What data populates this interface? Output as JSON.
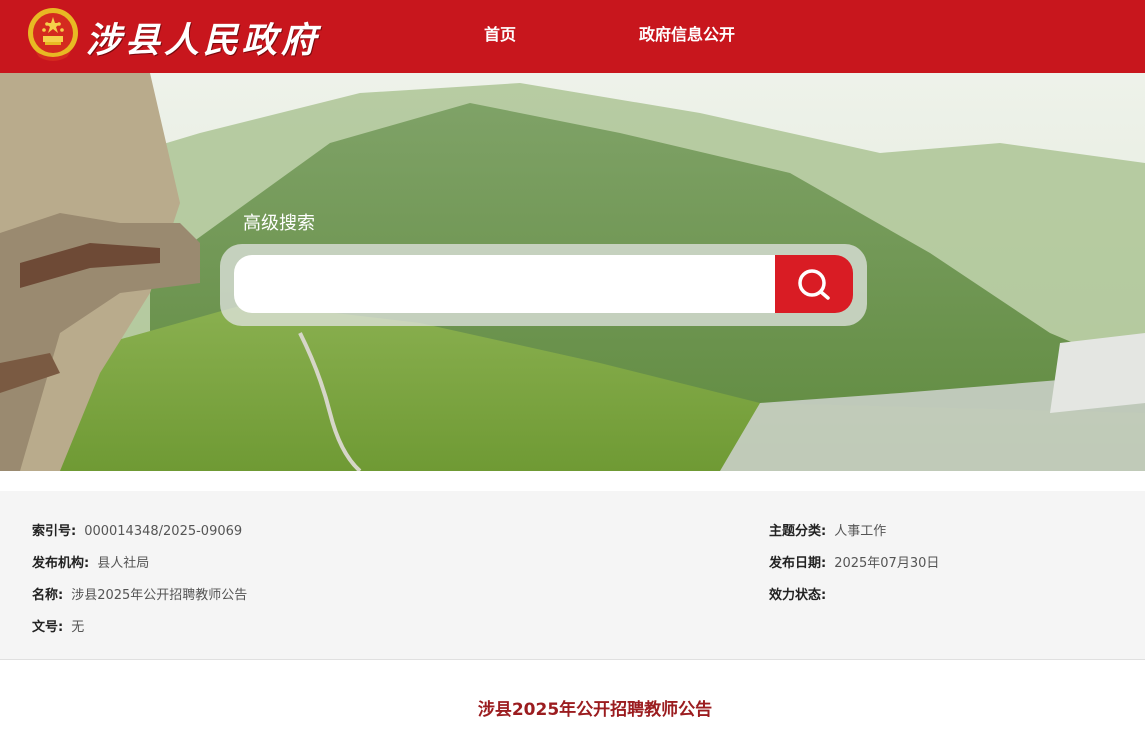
{
  "header": {
    "site_title": "涉县人民政府",
    "nav": {
      "home": "首页",
      "gov_info": "政府信息公开"
    }
  },
  "search": {
    "label": "高级搜索",
    "value": "",
    "placeholder": ""
  },
  "info": {
    "left": [
      {
        "key": "索引号:",
        "value": "000014348/2025-09069"
      },
      {
        "key": "发布机构:",
        "value": "县人社局"
      },
      {
        "key": "名称:",
        "value": "涉县2025年公开招聘教师公告"
      },
      {
        "key": "文号:",
        "value": "无"
      }
    ],
    "right": [
      {
        "key": "主题分类:",
        "value": "人事工作"
      },
      {
        "key": "发布日期:",
        "value": "2025年07月30日"
      },
      {
        "key": "效力状态:",
        "value": ""
      }
    ]
  },
  "article": {
    "title": "涉县2025年公开招聘教师公告"
  },
  "colors": {
    "header_red": "#c8161d",
    "button_red": "#d91c24",
    "title_red": "#9b1c1f"
  }
}
